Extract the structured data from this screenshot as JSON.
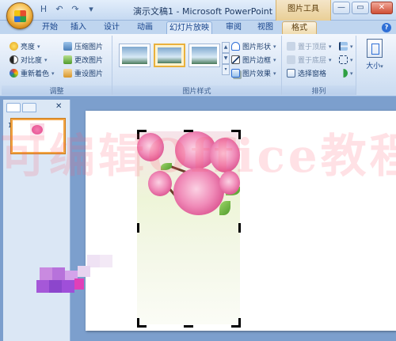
{
  "title_bar": {
    "title": "演示文稿1 - Microsoft PowerPoint",
    "context_title": "图片工具",
    "qat": [
      "H",
      "↶",
      "↷",
      "▾"
    ],
    "minimize": "—",
    "restore": "▭",
    "close": "✕"
  },
  "tabs": [
    "开始",
    "插入",
    "设计",
    "动画",
    "幻灯片放映",
    "审阅",
    "视图",
    "格式"
  ],
  "active_tab": "格式",
  "ribbon": {
    "adjust": {
      "label": "调整",
      "brightness": "亮度",
      "contrast": "对比度",
      "recolor": "重新着色",
      "compress": "压缩图片",
      "change": "更改图片",
      "reset": "重设图片"
    },
    "styles": {
      "label": "图片样式",
      "shape": "图片形状",
      "border": "图片边框",
      "effects": "图片效果"
    },
    "arrange": {
      "label": "排列",
      "front": "置于顶层",
      "back": "置于底层",
      "pane": "选择窗格"
    },
    "size": {
      "label": "大小"
    }
  },
  "slides_pane": {
    "close": "✕",
    "slide_number": "1"
  },
  "watermark": "可编辑Office教程网",
  "colors": {
    "accent_format_tab": "#f0dcb0",
    "selected_thumb": "#f3a545",
    "ribbon_text": "#15428b"
  }
}
